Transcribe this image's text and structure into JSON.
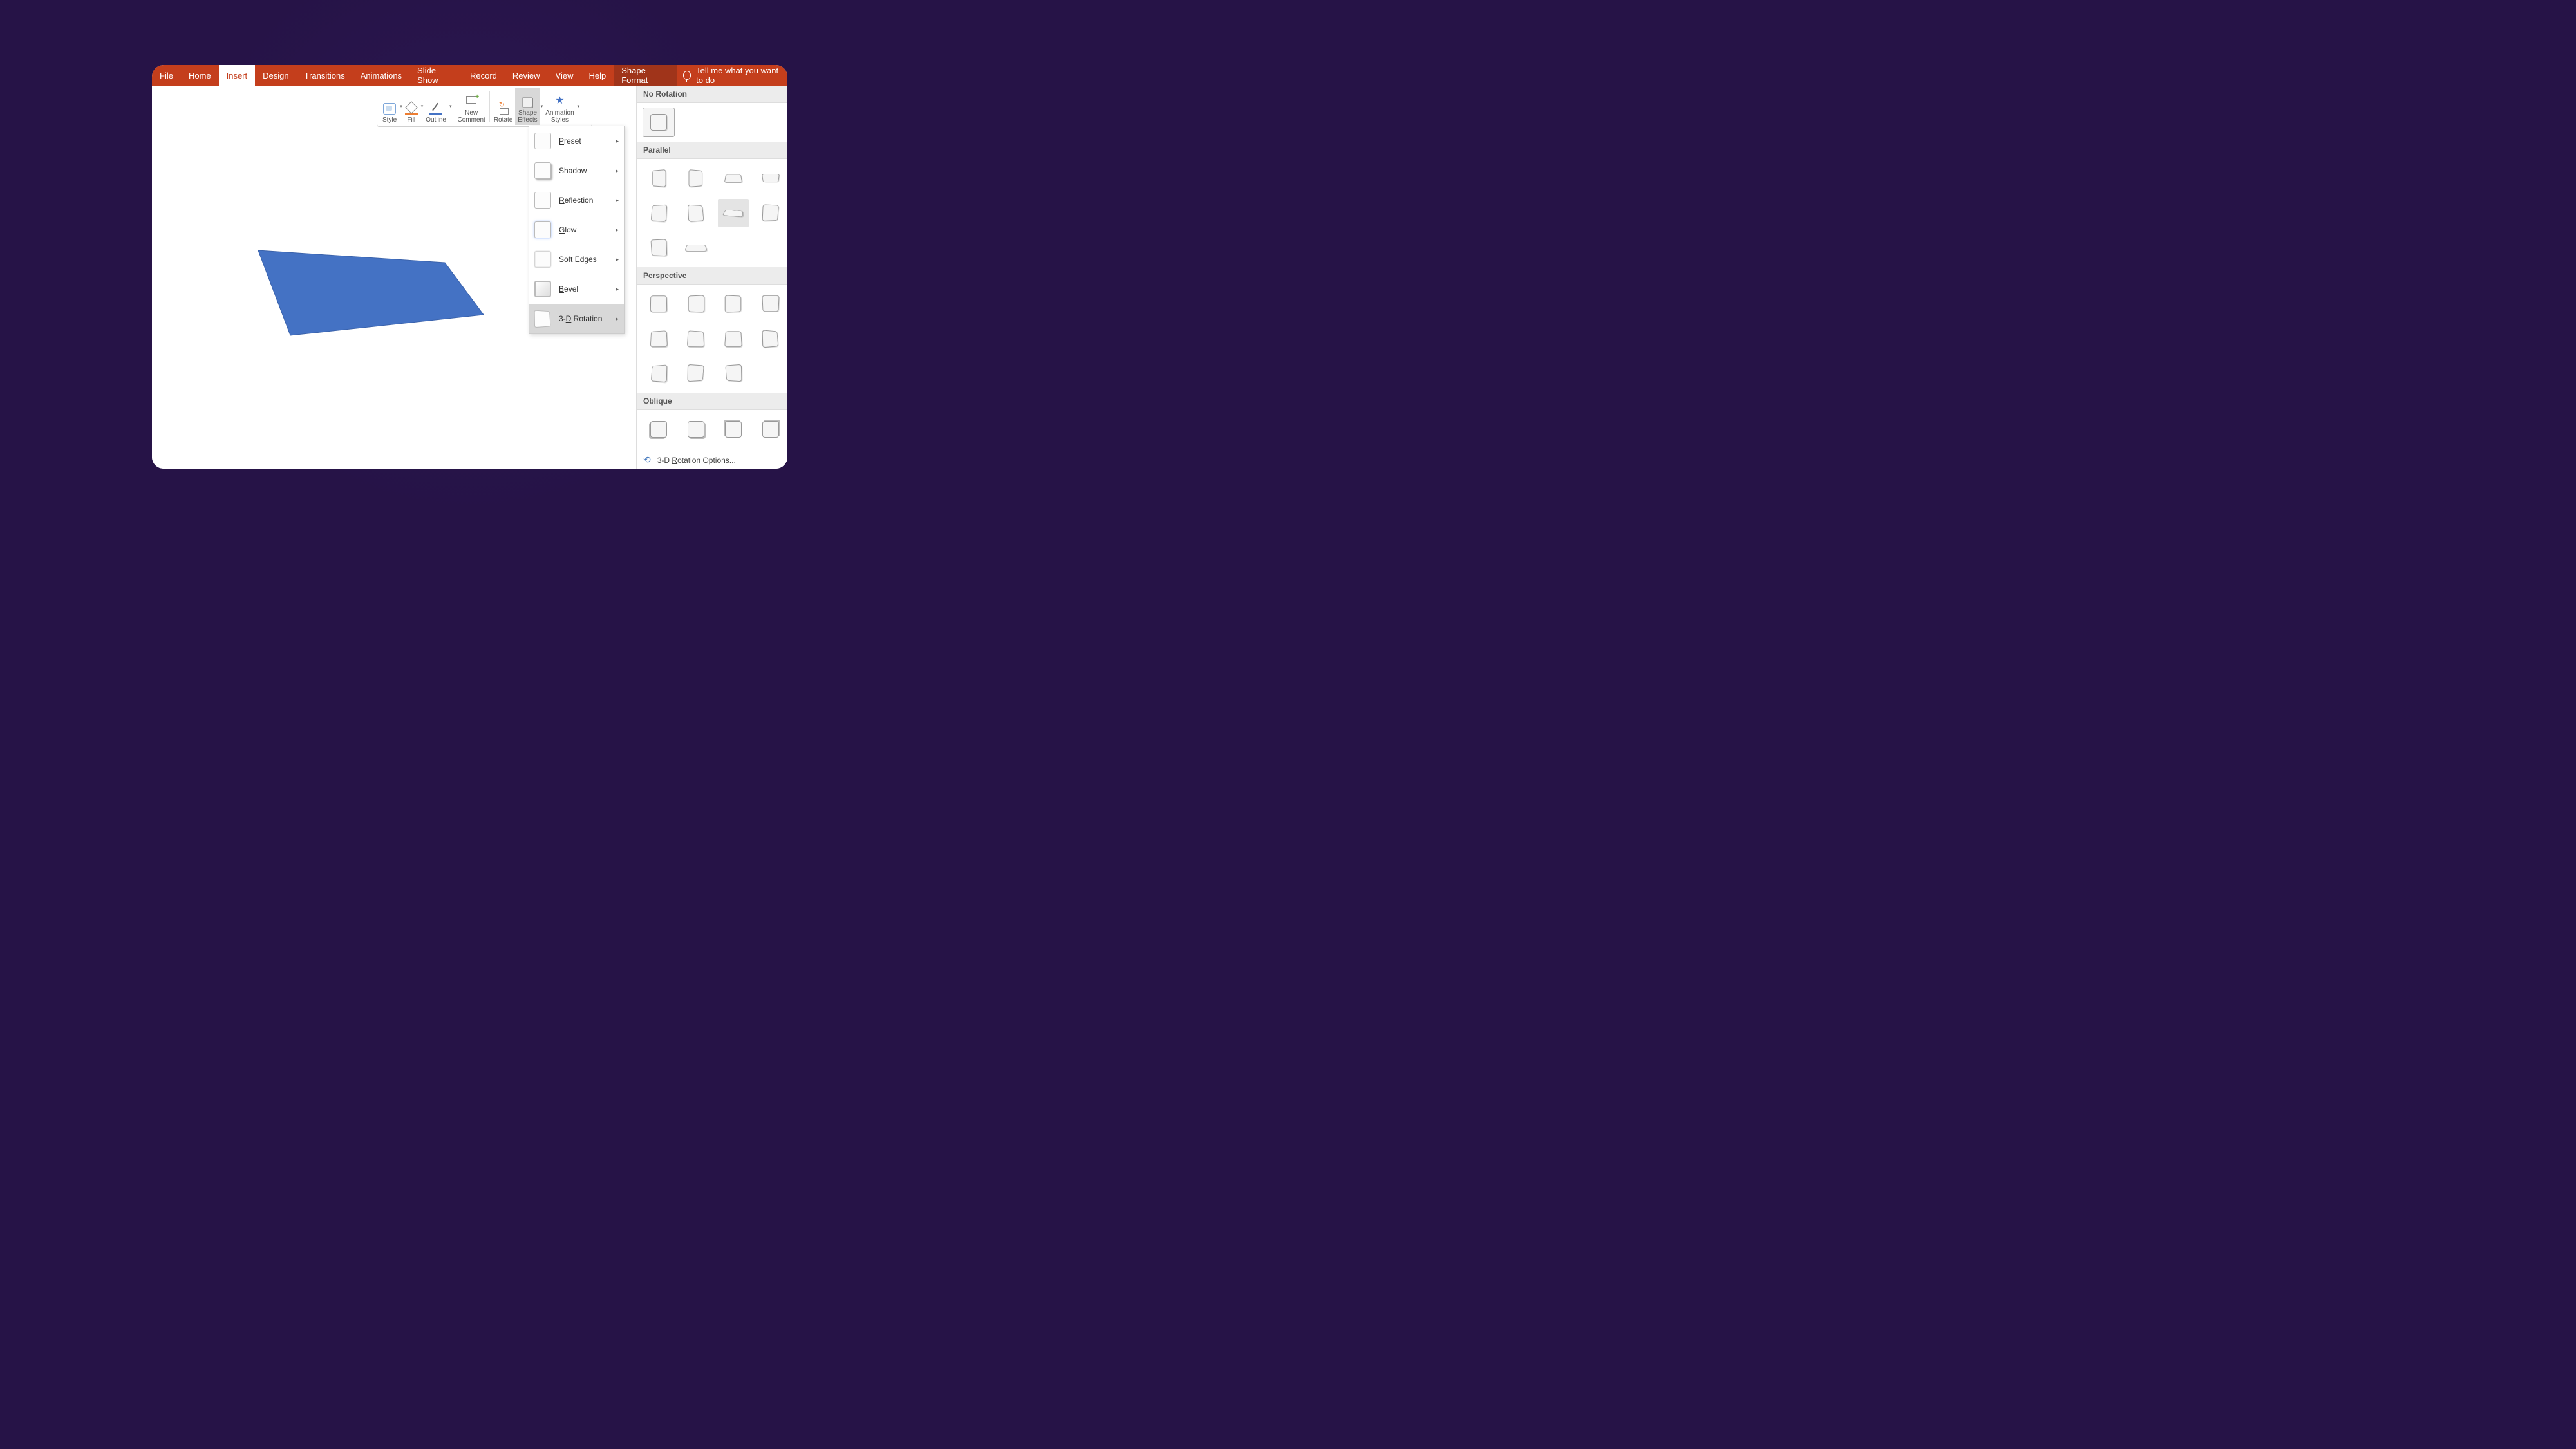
{
  "ribbon": {
    "tabs": [
      "File",
      "Home",
      "Insert",
      "Design",
      "Transitions",
      "Animations",
      "Slide Show",
      "Record",
      "Review",
      "View",
      "Help",
      "Shape Format"
    ],
    "active": "Insert",
    "contextual": "Shape Format",
    "search_placeholder": "Tell me what you want to do"
  },
  "mini_toolbar": {
    "style": "Style",
    "fill": "Fill",
    "outline": "Outline",
    "new_comment": "New\nComment",
    "rotate": "Rotate",
    "shape_effects": "Shape\nEffects",
    "animation_styles": "Animation\nStyles"
  },
  "effects_menu": {
    "items": [
      {
        "label": "Preset",
        "u": "P"
      },
      {
        "label": "Shadow",
        "u": "S"
      },
      {
        "label": "Reflection",
        "u": "R"
      },
      {
        "label": "Glow",
        "u": "G"
      },
      {
        "label": "Soft Edges",
        "u": "E"
      },
      {
        "label": "Bevel",
        "u": "B"
      },
      {
        "label": "3-D Rotation",
        "u": "D"
      }
    ],
    "active": "3-D Rotation"
  },
  "rotation_panel": {
    "no_rotation": "No Rotation",
    "parallel": "Parallel",
    "perspective": "Perspective",
    "oblique": "Oblique",
    "options": "3-D Rotation Options..."
  },
  "colors": {
    "ribbon": "#c43e1c",
    "shape": "#4472c4"
  }
}
